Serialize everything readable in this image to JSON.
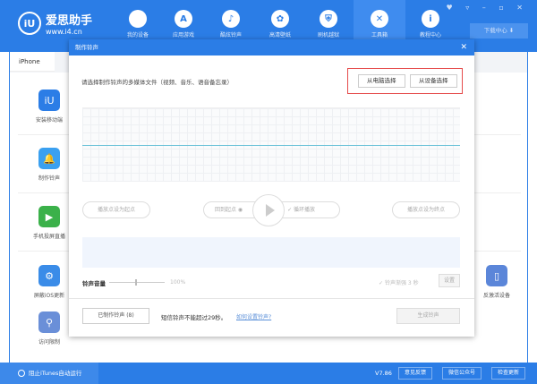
{
  "app": {
    "logo_title": "爱思助手",
    "logo_url": "www.i4.cn",
    "logo_mark": "iU",
    "download_center": "下载中心 ⬇",
    "window_controls": "♥ ▿ – ▫ ✕"
  },
  "nav": [
    {
      "label": "我的设备",
      "icon": ""
    },
    {
      "label": "应用游戏",
      "icon": "A"
    },
    {
      "label": "酷炫铃声",
      "icon": "♪"
    },
    {
      "label": "高清壁纸",
      "icon": "✿"
    },
    {
      "label": "刷机越狱",
      "icon": "⛨"
    },
    {
      "label": "工具箱",
      "icon": "✕"
    },
    {
      "label": "教程中心",
      "icon": "i"
    }
  ],
  "tab": "iPhone",
  "tools": [
    {
      "label": "安装移动端",
      "icon": "iU",
      "color": "#2b7de6"
    },
    {
      "label": "制作铃声",
      "icon": "🔔",
      "color": "#3aa0f0"
    },
    {
      "label": "手机投屏直播",
      "icon": "▶",
      "color": "#3bb14a"
    },
    {
      "label": "屏蔽iOS更新",
      "icon": "⚙",
      "color": "#3a8ce8"
    },
    {
      "label": "访问限制",
      "icon": "⚲",
      "color": "#6a8fd8"
    }
  ],
  "right_tool": {
    "label": "反激活设备",
    "icon": "▯",
    "color": "#5b86d9"
  },
  "modal": {
    "title": "制作铃声",
    "close": "✕",
    "prompt": "请选择制作铃声的多媒体文件（视频、音乐、语音备忘录）",
    "from_pc": "从电脑选择",
    "from_device": "从设备选择",
    "set_start": "播放点设为起点",
    "back_to_start": "回到起点",
    "loop": "循环播放",
    "set_end": "播放点设为终点",
    "volume_label": "铃声音量",
    "volume_value": "100%",
    "volume_fraction": 1.0,
    "fade": "铃声渐强 3 秒",
    "set": "设置",
    "made": "已制作铃声 (8)",
    "note": "短信铃声不能超过29秒。",
    "howto": "如何设置铃声?",
    "generate": "生成铃声"
  },
  "status": {
    "itunes": "阻止iTunes自动运行",
    "version": "V7.86",
    "feedback": "意见反馈",
    "wechat": "微信公众号",
    "update": "检查更新"
  }
}
